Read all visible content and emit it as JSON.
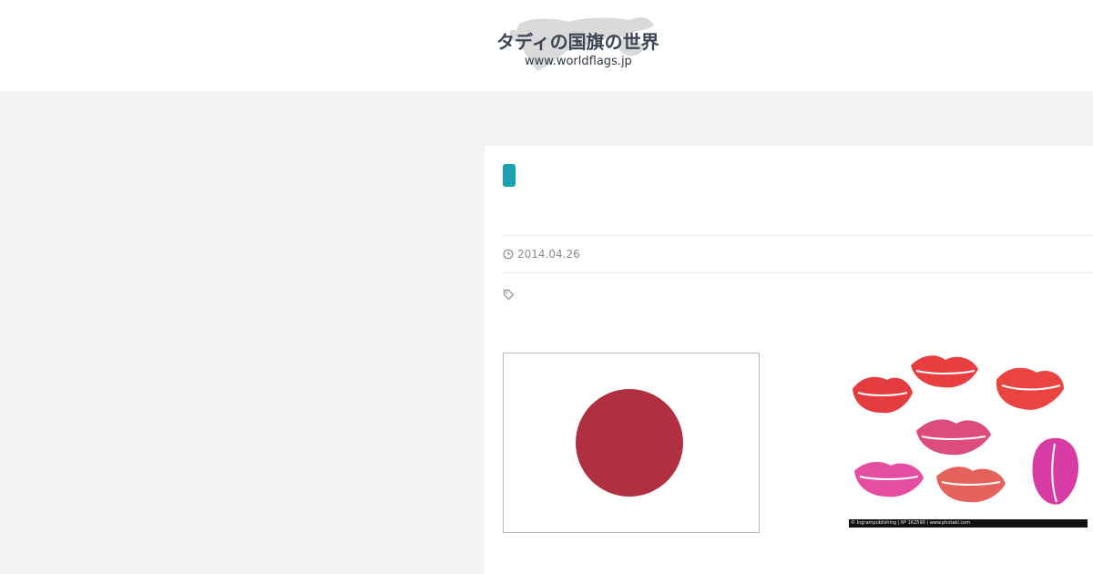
{
  "site": {
    "title": "タディの国旗の世界",
    "url": "www.worldflags.jp",
    "colors": {
      "title": "#3d4656",
      "background": "#f4f4f4",
      "accent": "#17a2ad"
    }
  },
  "post": {
    "category_color": "#17a2ad",
    "date_icon": "clock-icon",
    "date": "2014.04.26",
    "tag_icon": "tag-icon"
  },
  "images": {
    "flag": {
      "name": "japan-flag",
      "circle_color": "#b03041"
    },
    "lips": {
      "credit": "© Ingrampublishing | Nº 162590 | www.photaki.com"
    }
  }
}
